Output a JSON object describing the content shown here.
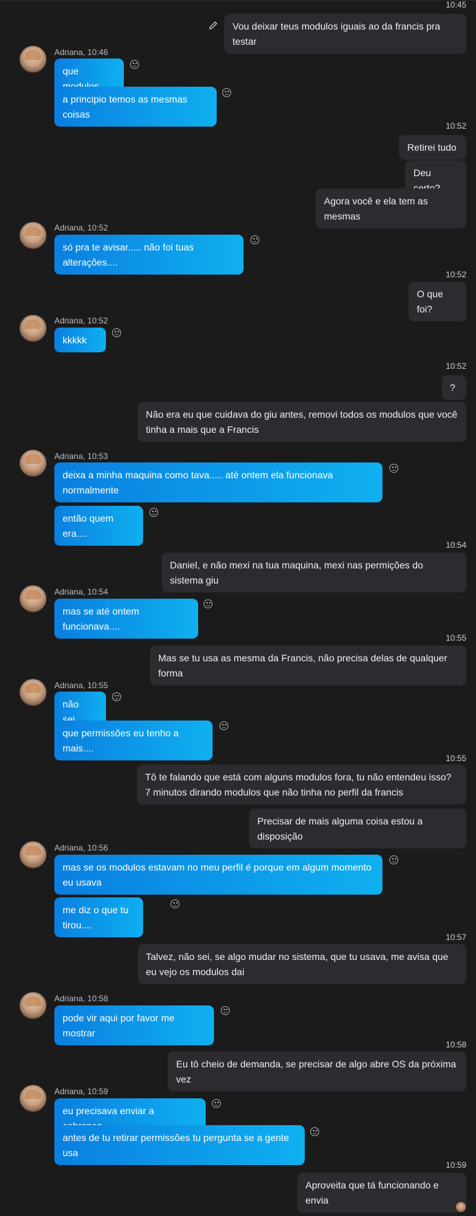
{
  "contact": {
    "name": "Adriana"
  },
  "timestamps": {
    "t0": "10:45",
    "t1": "10:52",
    "t2": "10:52",
    "t3": "10:52",
    "t4": "10:54",
    "t5": "10:55",
    "t6": "10:55",
    "t7": "10:57",
    "t8": "10:58",
    "t9": "10:59"
  },
  "headers": {
    "h1": "Adriana, 10:46",
    "h2": "Adriana, 10:52",
    "h3": "Adriana, 10:52",
    "h4": "Adriana, 10:53",
    "h5": "Adriana, 10:54",
    "h6": "Adriana, 10:55",
    "h7": "Adriana, 10:56",
    "h8": "Adriana, 10:58",
    "h9": "Adriana, 10:59"
  },
  "messages": {
    "m01": "Vou deixar teus modulos iguais ao da francis pra testar",
    "m02": "que modulos",
    "m03": "a principio temos as mesmas coisas",
    "m04": "Retirei tudo",
    "m05": "Deu certo?",
    "m06": "Agora você e ela tem as mesmas",
    "m07": "só pra te avisar..... não foi tuas alterações....",
    "m08": "O que foi?",
    "m09": "kkkkk",
    "m10": "?",
    "m11": "Não era eu que cuidava do giu antes, removi todos os modulos que você tinha a mais que a Francis",
    "m12": "deixa a minha maquina como tava..... até ontem ela funcionava normalmente",
    "m13": "então quem era....",
    "m14": "Daniel, e não mexi na tua maquina, mexi nas permições do sistema giu",
    "m15": "mas se até ontem funcionava....",
    "m16": "Mas se tu usa as mesma da Francis, não precisa delas de qualquer forma",
    "m17": "não sei...",
    "m18": "que permissões eu tenho a  mais....",
    "m19": "Tô te falando que está com alguns modulos fora, tu não entendeu isso? 7 minutos dirando modulos que não tinha no perfil da francis",
    "m20": "Precisar de mais alguma coisa estou a disposição",
    "m21": "mas se os modulos estavam no meu perfil é porque em algum momento eu usava",
    "m22": "me diz o que tu tirou....",
    "m23": "Talvez, não sei, se algo mudar no sistema, que tu usava, me avisa que eu vejo os modulos dai",
    "m24": "pode vir aqui por favor me mostrar",
    "m25": "Eu tô cheio de demanda, se precisar de algo abre OS da próxima vez",
    "m26": "eu precisava enviar a cobrança.....",
    "m27": "antes de tu retirar permissões tu pergunta se a gente usa",
    "m28": "Aproveita que tá funcionando e envia"
  },
  "colors": {
    "background": "#1b1b1c",
    "outgoing_bubble": "#2b2b30",
    "incoming_gradient_start": "#0a7fe0",
    "incoming_gradient_end": "#0fb0f0"
  },
  "icons": [
    "edit-pencil-icon",
    "reaction-smiley-icon",
    "avatar"
  ]
}
